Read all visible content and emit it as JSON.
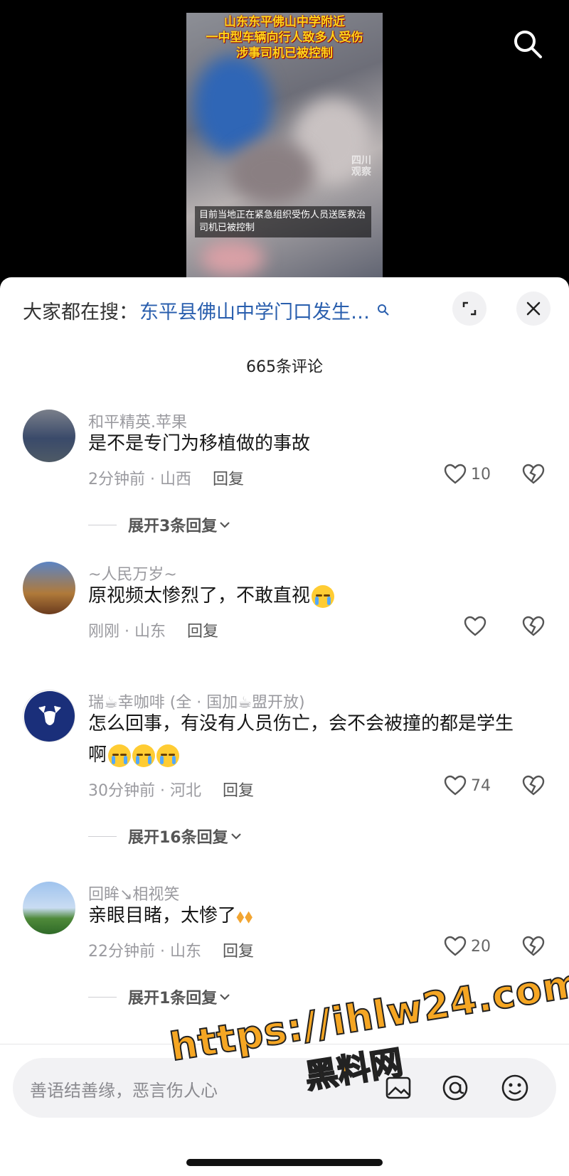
{
  "video": {
    "headline": [
      "山东东平佛山中学附近",
      "一中型车辆向行人致多人受伤",
      "涉事司机已被控制"
    ],
    "caption": "目前当地正在紧急组织受伤人员送医救治\n司机已被控制",
    "logo": "四川\n观察"
  },
  "search_bar": {
    "label": "大家都在搜：",
    "query": "东平县佛山中学门口发生…"
  },
  "comments_count": "665条评论",
  "comments": [
    {
      "user": "和平精英.苹果",
      "text": "是不是专门为移植做的事故",
      "time_loc": "2分钟前 · 山西",
      "reply": "回复",
      "likes": "10",
      "expand": "展开3条回复"
    },
    {
      "user": "~人民万岁~",
      "text": "原视频太惨烈了，不敢直视",
      "time_loc": "刚刚 · 山东",
      "reply": "回复",
      "likes": "",
      "expand": ""
    },
    {
      "user": "瑞☕幸咖啡 (全 · 国加☕盟开放)",
      "text": "怎么回事，有没有人员伤亡，会不会被撞的都是学生啊",
      "time_loc": "30分钟前 · 河北",
      "reply": "回复",
      "likes": "74",
      "expand": "展开16条回复"
    },
    {
      "user": "回眸↘相视笑",
      "text": "亲眼目睹，太惨了",
      "time_loc": "22分钟前 · 山东",
      "reply": "回复",
      "likes": "20",
      "expand": "展开1条回复"
    }
  ],
  "input": {
    "placeholder": "善语结善缘，恶言伤人心"
  },
  "watermark": {
    "line1": "https://ihlw24.com",
    "line2": "黑料网"
  },
  "colors": {
    "link": "#2a5fae",
    "accent": "#f5a623"
  }
}
